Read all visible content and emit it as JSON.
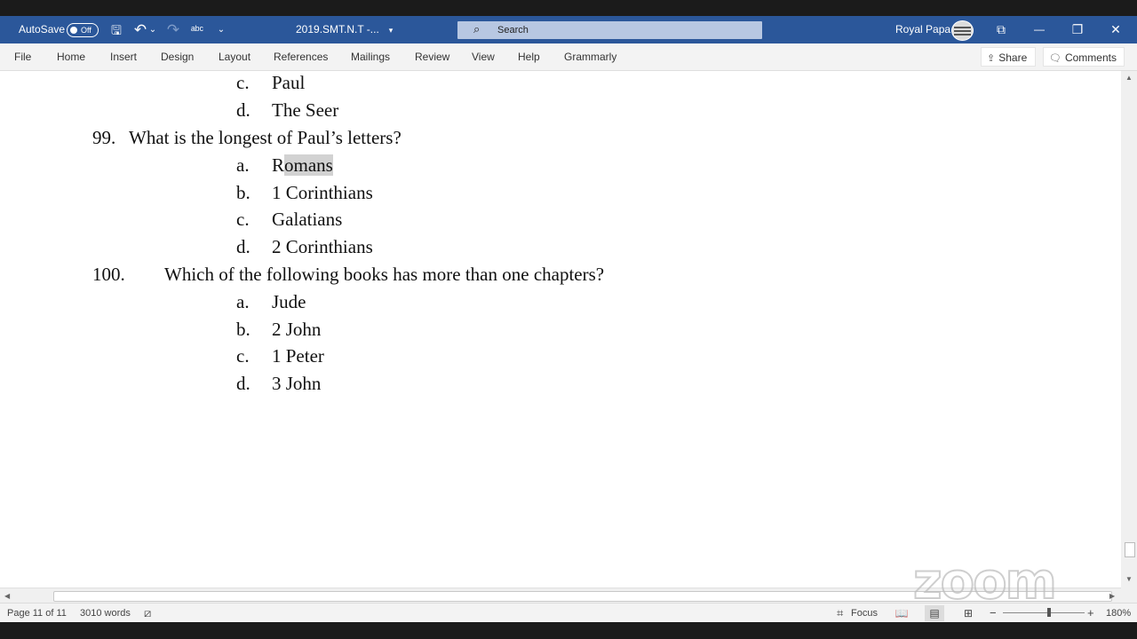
{
  "titlebar": {
    "autosave_label": "AutoSave",
    "autosave_state": "Off",
    "document_name": "2019.SMT.N.T  -...",
    "search_placeholder": "Search",
    "user_name": "Royal Papa",
    "icons": {
      "save": "save-icon",
      "undo": "undo-icon",
      "redo": "redo-icon",
      "spelling": "spelling-icon",
      "customize": "customize-quick-access-icon",
      "title_dropdown": "chevron-down-icon",
      "search": "search-icon",
      "ribbon_display": "ribbon-display-options-icon",
      "minimize": "minimize-icon",
      "restore": "restore-icon",
      "close": "close-icon"
    },
    "glyphs": {
      "save": "🖫",
      "undo": "↶",
      "undo_dropdown": "⌄",
      "redo": "↷",
      "spelling": "ᵃᵇᶜ",
      "customize": "⌄",
      "title_dropdown": "▾",
      "search": "⌕",
      "ribbon_display": "⧉",
      "minimize": "—",
      "restore": "❐",
      "close": "✕"
    },
    "brand_color": "#2b579a"
  },
  "menubar": {
    "items": [
      "File",
      "Home",
      "Insert",
      "Design",
      "Layout",
      "References",
      "Mailings",
      "Review",
      "View",
      "Help",
      "Grammarly"
    ],
    "share_label": "Share",
    "comments_label": "Comments",
    "share_glyph": "⇪",
    "comments_glyph": "🗨"
  },
  "document": {
    "lines": [
      {
        "label": "c.",
        "text": "Paul"
      },
      {
        "label": "d.",
        "text": "The Seer"
      },
      {
        "number": "99.",
        "question": "What is the longest of Paul’s letters?"
      },
      {
        "label": "a.",
        "text_first": "R",
        "text_highlighted": "omans"
      },
      {
        "label": "b.",
        "text": "1 Corinthians"
      },
      {
        "label": "c.",
        "text": "Galatians"
      },
      {
        "label": "d.",
        "text": "2 Corinthians"
      },
      {
        "number": "100.",
        "question": "Which of the following books has more than one chapters?"
      },
      {
        "label": "a.",
        "text": "Jude"
      },
      {
        "label": "b.",
        "text": "2 John"
      },
      {
        "label": "c.",
        "text": "1 Peter"
      },
      {
        "label": "d.",
        "text": "3 John"
      }
    ],
    "highlight_color": "#d2d2d2"
  },
  "overlay": {
    "zoom_watermark": "zoom"
  },
  "statusbar": {
    "page_info": "Page 11 of 11",
    "word_count": "3010 words",
    "focus_label": "Focus",
    "zoom_level": "180%",
    "zoom_minus": "−",
    "zoom_plus": "+",
    "glyphs": {
      "proofing": "⧄",
      "focus": "⌗",
      "read_mode": "📖",
      "print_layout": "▤",
      "web_layout": "⊞"
    }
  },
  "scrollbars": {
    "up": "▲",
    "down": "▼",
    "left": "◀",
    "right": "▶"
  }
}
